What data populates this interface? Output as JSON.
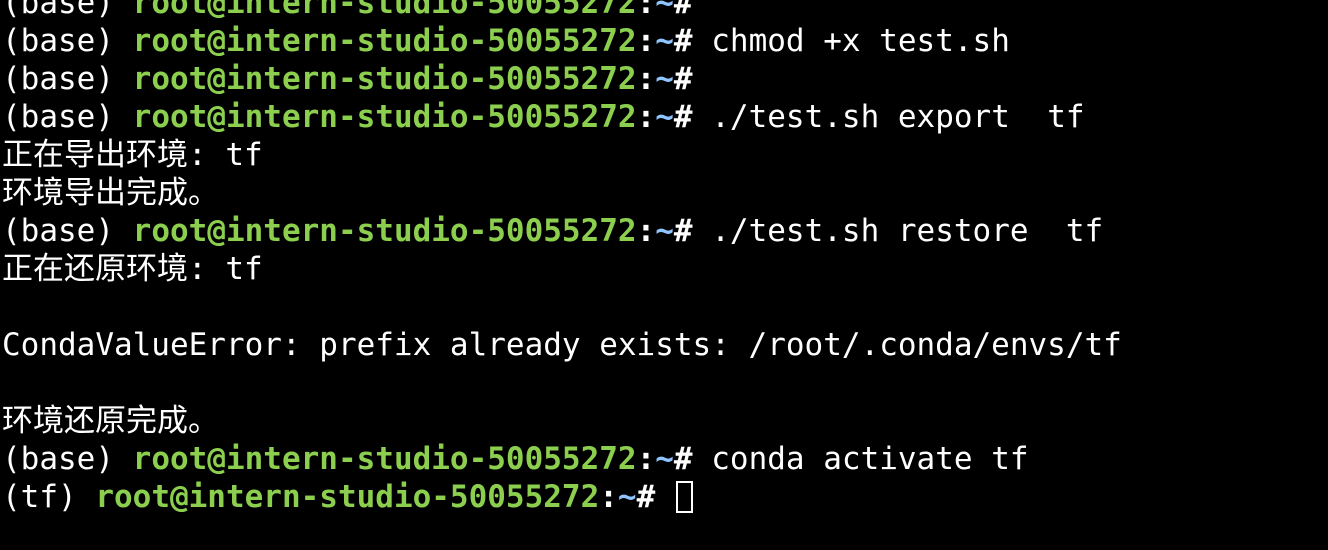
{
  "terminal": {
    "colors": {
      "background": "#000000",
      "text": "#ffffff",
      "userhost": "#8ccf4f",
      "path": "#8ec5ff"
    },
    "lines": [
      {
        "env": "(base) ",
        "userhost": "root@intern-studio-50055272",
        "colon": ":",
        "path": "~",
        "hash": "#",
        "cmd": ""
      },
      {
        "env": "(base) ",
        "userhost": "root@intern-studio-50055272",
        "colon": ":",
        "path": "~",
        "hash": "#",
        "cmd": " chmod +x test.sh"
      },
      {
        "env": "(base) ",
        "userhost": "root@intern-studio-50055272",
        "colon": ":",
        "path": "~",
        "hash": "#",
        "cmd": ""
      },
      {
        "env": "(base) ",
        "userhost": "root@intern-studio-50055272",
        "colon": ":",
        "path": "~",
        "hash": "#",
        "cmd": " ./test.sh export  tf"
      },
      {
        "text": "正在导出环境: tf"
      },
      {
        "text": "环境导出完成。"
      },
      {
        "env": "(base) ",
        "userhost": "root@intern-studio-50055272",
        "colon": ":",
        "path": "~",
        "hash": "#",
        "cmd": " ./test.sh restore  tf"
      },
      {
        "text": "正在还原环境: tf"
      },
      {
        "text": ""
      },
      {
        "text": "CondaValueError: prefix already exists: /root/.conda/envs/tf"
      },
      {
        "text": ""
      },
      {
        "text": "环境还原完成。"
      },
      {
        "env": "(base) ",
        "userhost": "root@intern-studio-50055272",
        "colon": ":",
        "path": "~",
        "hash": "#",
        "cmd": " conda activate tf"
      },
      {
        "env": "(tf) ",
        "userhost": "root@intern-studio-50055272",
        "colon": ":",
        "path": "~",
        "hash": "#",
        "cmd": " ",
        "cursor": true
      }
    ]
  }
}
